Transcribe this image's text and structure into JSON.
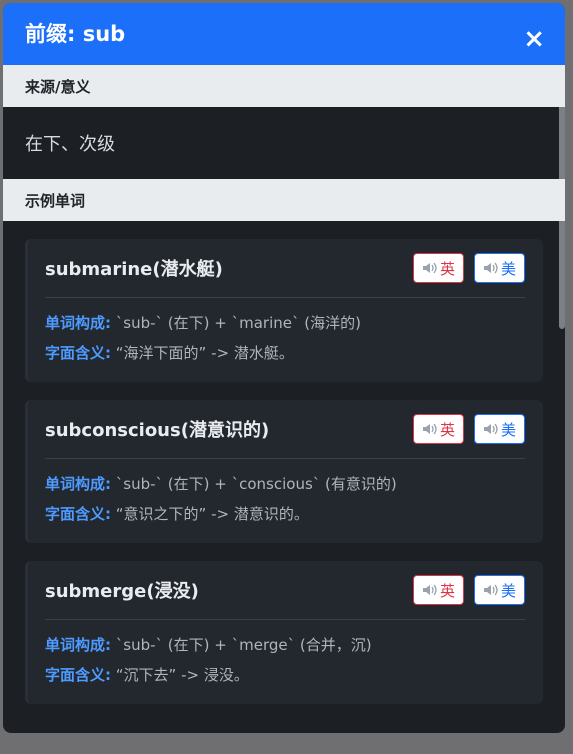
{
  "header": {
    "title": "前缀: sub",
    "close": "×"
  },
  "origin": {
    "heading": "来源/意义",
    "text": "在下、次级"
  },
  "examples": {
    "heading": "示例单词"
  },
  "buttons": {
    "uk": "英",
    "us": "美"
  },
  "labels": {
    "formation": "单词构成:",
    "meaning": "字面含义:"
  },
  "words": [
    {
      "word": "submarine(潜水艇)",
      "formation": "`sub-` (在下) + `marine` (海洋的)",
      "meaning": "“海洋下面的” -> 潜水艇。"
    },
    {
      "word": "subconscious(潜意识的)",
      "formation": "`sub-` (在下) + `conscious` (有意识的)",
      "meaning": "“意识之下的” -> 潜意识的。"
    },
    {
      "word": "submerge(浸没)",
      "formation": "`sub-` (在下) + `merge` (合并，沉)",
      "meaning": "“沉下去” -> 浸没。"
    }
  ]
}
